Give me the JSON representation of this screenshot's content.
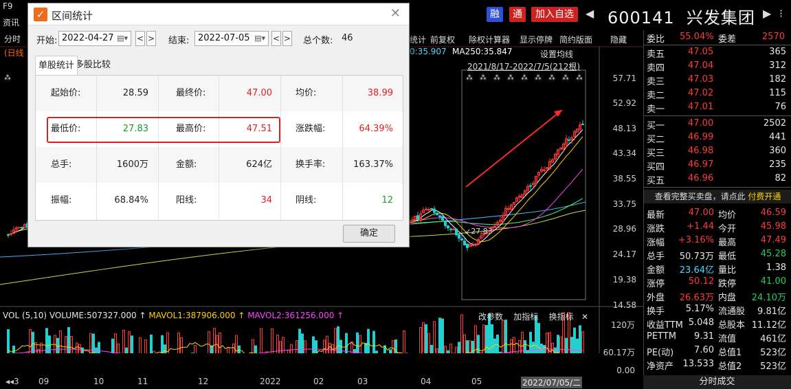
{
  "topbar": {
    "f9": "F9",
    "zixun": "资讯",
    "fenshi": "分时",
    "rixian": "(日线",
    "btn_rong": "融",
    "btn_tong": "通",
    "btn_add": "加入自选",
    "prev_arrow": "◀",
    "next_arrow": "▶",
    "more": "⁝",
    "stock_code": "600141",
    "stock_name": "兴发集团"
  },
  "toolbar": {
    "items": [
      "统计",
      "前复权",
      "除权计算器",
      "显示停牌",
      "简约版面",
      "隐藏"
    ]
  },
  "ma_line": {
    "ma_prev": "0:35.907",
    "ma250": "MA250:35.847",
    "setting": "设置均线",
    "range": "2021/8/17-2022/7/5(212根)"
  },
  "price_axis": [
    "57.71",
    "52.92",
    "48.13",
    "43.34",
    "38.55",
    "33.75",
    "28.96",
    "24.17",
    "19.38",
    "14.58"
  ],
  "low_marker": "27.83",
  "volume": {
    "label": "VOL (5,10)",
    "volume": "VOLUME:507327.000",
    "mavol1": "MAVOL1:387906.000",
    "mavol2": "MAVOL2:361256.000",
    "tools": [
      "改参数",
      "加指标",
      "换指标"
    ],
    "axis": [
      "120万",
      "60.17万",
      "0.00"
    ]
  },
  "x_axis": [
    "3",
    "09",
    "10",
    "11",
    "12",
    "2022",
    "02",
    "03",
    "04",
    "05",
    "2022/07/05/二"
  ],
  "dialog": {
    "title": "区间统计",
    "start_label": "开始:",
    "start_date": "2022-04-27",
    "end_label": "结束:",
    "end_date": "2022-07-05",
    "total_label": "总个数:",
    "total": "46",
    "tab_single": "单股统计",
    "tab_multi": "多股比较",
    "ok": "确定",
    "rows": [
      [
        {
          "l": "起始价:",
          "v": "28.59",
          "c": "#222"
        },
        {
          "l": "最终价:",
          "v": "47.00",
          "c": "#e02020"
        },
        {
          "l": "均价:",
          "v": "38.99",
          "c": "#e02020"
        }
      ],
      [
        {
          "l": "最低价:",
          "v": "27.83",
          "c": "#1a9a2a"
        },
        {
          "l": "最高价:",
          "v": "47.51",
          "c": "#e02020"
        },
        {
          "l": "涨跌幅:",
          "v": "64.39%",
          "c": "#e02020"
        }
      ],
      [
        {
          "l": "总手:",
          "v": "1600万",
          "c": "#222"
        },
        {
          "l": "金额:",
          "v": "624亿",
          "c": "#222"
        },
        {
          "l": "换手率:",
          "v": "163.37%",
          "c": "#222"
        }
      ],
      [
        {
          "l": "振幅:",
          "v": "68.84%",
          "c": "#222"
        },
        {
          "l": "阳线:",
          "v": "34",
          "c": "#e02020"
        },
        {
          "l": "阴线:",
          "v": "12",
          "c": "#1a9a2a"
        }
      ]
    ]
  },
  "orderbook": {
    "weibi_label": "委比",
    "weibi": "55.04%",
    "weicha_label": "委差",
    "weicha": "2570",
    "sells": [
      {
        "label": "卖五",
        "price": "47.05",
        "vol": "365"
      },
      {
        "label": "卖四",
        "price": "47.04",
        "vol": "312"
      },
      {
        "label": "卖三",
        "price": "47.03",
        "vol": "182"
      },
      {
        "label": "卖二",
        "price": "47.02",
        "vol": "115"
      },
      {
        "label": "卖一",
        "price": "47.01",
        "vol": "76"
      }
    ],
    "buys": [
      {
        "label": "买一",
        "price": "47.00",
        "vol": "2502"
      },
      {
        "label": "买二",
        "price": "46.99",
        "vol": "441"
      },
      {
        "label": "买三",
        "price": "46.98",
        "vol": "360"
      },
      {
        "label": "买四",
        "price": "46.97",
        "vol": "235"
      },
      {
        "label": "买五",
        "price": "46.96",
        "vol": "82"
      }
    ],
    "promo_text": "查看完整买卖盘，请点此",
    "promo_link": "付费开通"
  },
  "quotes": [
    [
      {
        "l": "最新",
        "v": "47.00",
        "c": "#ff3b3b"
      },
      {
        "l": "均价",
        "v": "46.59",
        "c": "#ff3b3b"
      }
    ],
    [
      {
        "l": "涨跌",
        "v": "+1.44",
        "c": "#ff3b3b"
      },
      {
        "l": "今开",
        "v": "45.98",
        "c": "#ff3b3b"
      }
    ],
    [
      {
        "l": "涨幅",
        "v": "+3.16%",
        "c": "#ff3b3b"
      },
      {
        "l": "最高",
        "v": "47.49",
        "c": "#ff3b3b"
      }
    ],
    [
      {
        "l": "总手",
        "v": "50.73万",
        "c": "#e6e6e6"
      },
      {
        "l": "最低",
        "v": "45.28",
        "c": "#22d05a"
      }
    ],
    [
      {
        "l": "金额",
        "v": "23.64亿",
        "c": "#4fd8ff"
      },
      {
        "l": "量比",
        "v": "1.38",
        "c": "#e6e6e6"
      }
    ],
    [
      {
        "l": "涨停",
        "v": "50.12",
        "c": "#ff3b3b"
      },
      {
        "l": "跌停",
        "v": "41.00",
        "c": "#22d05a"
      }
    ],
    [
      {
        "l": "外盘",
        "v": "26.63万",
        "c": "#ff3b3b"
      },
      {
        "l": "内盘",
        "v": "24.10万",
        "c": "#22d05a"
      }
    ],
    [
      {
        "l": "换手",
        "v": "5.17%",
        "c": "#e6e6e6"
      },
      {
        "l": "流通股",
        "v": "9.81亿",
        "c": "#e6e6e6"
      }
    ],
    [
      {
        "l": "收益TTM",
        "v": "5.048",
        "c": "#e6e6e6"
      },
      {
        "l": "总股本",
        "v": "11.12亿",
        "c": "#e6e6e6"
      }
    ],
    [
      {
        "l": "PETTM",
        "v": "9.31",
        "c": "#e6e6e6"
      },
      {
        "l": "流值",
        "v": "461亿",
        "c": "#e6e6e6"
      }
    ],
    [
      {
        "l": "PE(动)",
        "v": "7.60",
        "c": "#e6e6e6"
      },
      {
        "l": "总值1",
        "v": "523亿",
        "c": "#e6e6e6"
      }
    ],
    [
      {
        "l": "净资产",
        "v": "13.533",
        "c": "#e6e6e6"
      },
      {
        "l": "总值2",
        "v": "523亿",
        "c": "#e6e6e6"
      }
    ]
  ],
  "bottom_tab": "分时成交",
  "colors": {
    "up": "#ff3b3b",
    "down": "#22d05a",
    "accent": "#d12020",
    "blue": "#2f4fd6"
  }
}
